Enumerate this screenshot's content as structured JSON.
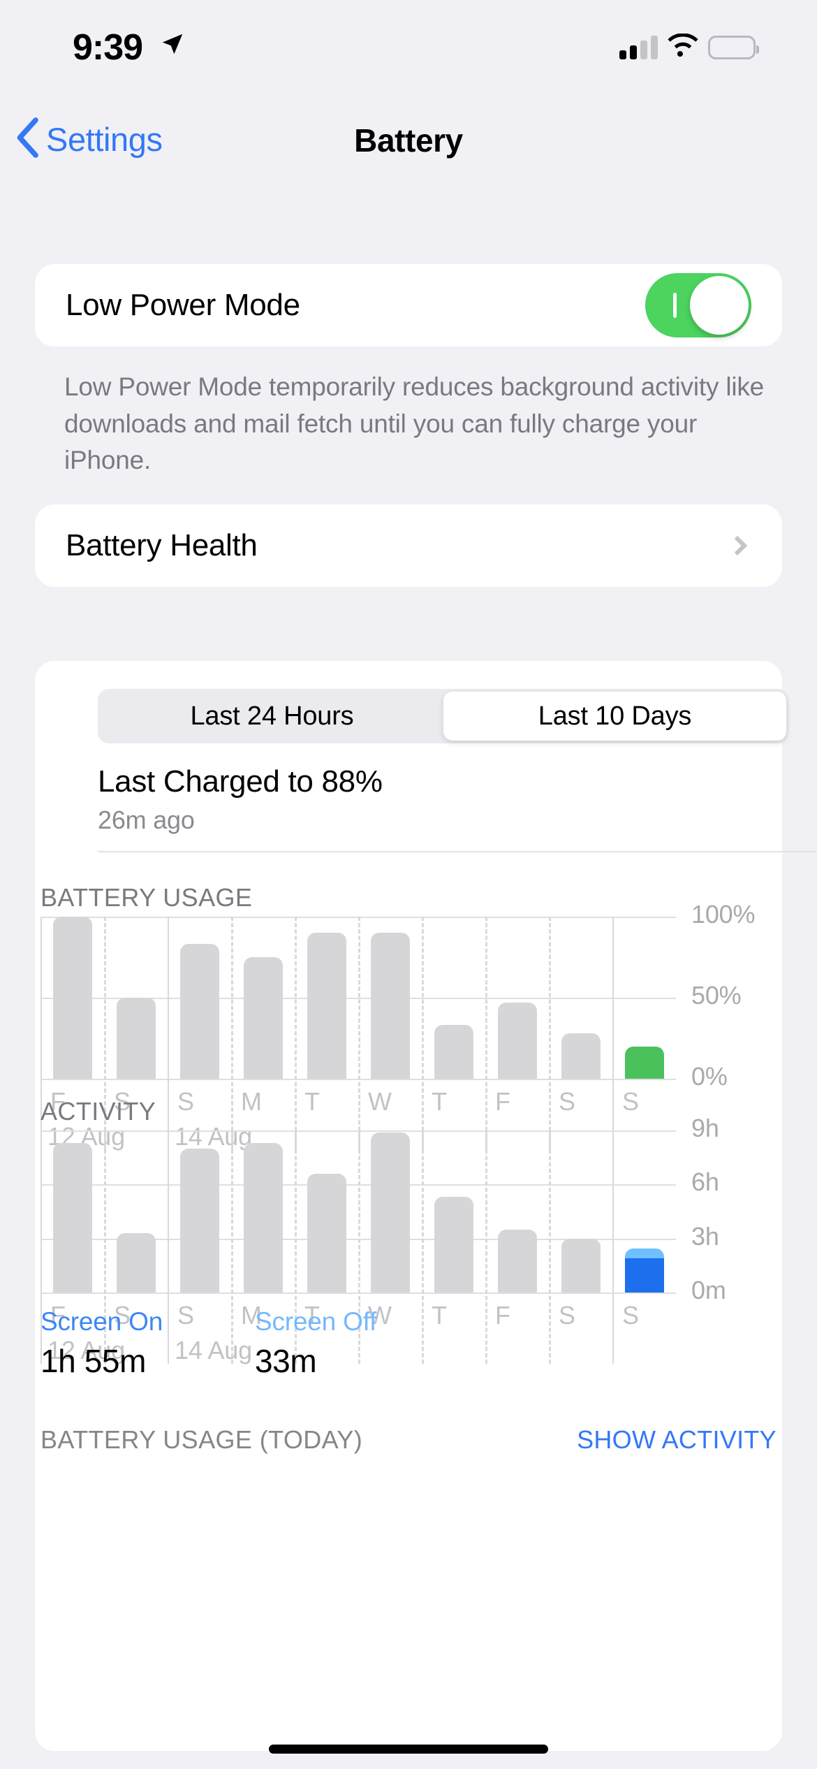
{
  "status_bar": {
    "time": "9:39",
    "location_icon": "location-arrow-icon",
    "cellular_icon": "cellular-signal-icon",
    "cellular_bars_filled": 2,
    "cellular_bars_total": 4,
    "wifi_icon": "wifi-icon",
    "battery_icon": "battery-icon",
    "battery_color": "#F8CE46"
  },
  "nav": {
    "back_label": "Settings",
    "back_icon": "chevron-left-icon",
    "title": "Battery",
    "tint": "#3478F6"
  },
  "low_power": {
    "label": "Low Power Mode",
    "toggle_state": "on",
    "toggle_color": "#4CD45F",
    "footnote": "Low Power Mode temporarily reduces background activity like downloads and mail fetch until you can fully charge your iPhone."
  },
  "battery_health": {
    "label": "Battery Health",
    "disclosure_icon": "chevron-right-icon"
  },
  "usage_card": {
    "segments": [
      {
        "label": "Last 24 Hours",
        "selected": false
      },
      {
        "label": "Last 10 Days",
        "selected": true
      }
    ],
    "last_charged_title": "Last Charged to 88%",
    "last_charged_sub": "26m ago"
  },
  "stats": {
    "screen_on_label": "Screen On",
    "screen_on_value": "1h 55m",
    "screen_on_color": "#3C87F6",
    "screen_off_label": "Screen Off",
    "screen_off_value": "33m",
    "screen_off_color": "#76B8FC"
  },
  "bottom": {
    "section_header": "BATTERY USAGE (TODAY)",
    "show_activity": "SHOW ACTIVITY"
  },
  "chart_data": [
    {
      "type": "bar",
      "title": "BATTERY USAGE",
      "xlabel": "",
      "ylabel": "",
      "categories": [
        "F",
        "S",
        "S",
        "M",
        "T",
        "W",
        "T",
        "F",
        "S",
        "S"
      ],
      "date_labels": [
        {
          "text": "12 Aug",
          "index": 0
        },
        {
          "text": "14 Aug",
          "index": 2
        }
      ],
      "values": [
        100,
        50,
        83,
        75,
        90,
        90,
        33,
        47,
        28,
        20
      ],
      "highlight_index": 9,
      "highlight_color": "#4BC15C",
      "bar_color": "#D6D6D9",
      "ylim": [
        0,
        100
      ],
      "yticks": [
        0,
        50,
        100
      ],
      "ytick_labels": [
        "0%",
        "50%",
        "100%"
      ],
      "grid": true,
      "legend": "none"
    },
    {
      "type": "bar",
      "title": "ACTIVITY",
      "xlabel": "",
      "ylabel": "",
      "categories": [
        "F",
        "S",
        "S",
        "M",
        "T",
        "W",
        "T",
        "F",
        "S",
        "S"
      ],
      "date_labels": [
        {
          "text": "12 Aug",
          "index": 0
        },
        {
          "text": "14 Aug",
          "index": 2
        }
      ],
      "values": [
        8.3,
        3.3,
        8.0,
        8.3,
        6.6,
        8.9,
        5.3,
        3.5,
        3.0,
        2.45
      ],
      "series": [
        {
          "name": "Screen On",
          "color": "#1E6FEE",
          "highlight_only_value": 1.92
        },
        {
          "name": "Screen Off",
          "color": "#6EC0FF",
          "highlight_only_value": 0.53
        }
      ],
      "highlight_index": 9,
      "bar_color": "#D6D6D9",
      "ylim": [
        0,
        9
      ],
      "yticks": [
        0,
        3,
        6,
        9
      ],
      "ytick_labels": [
        "0m",
        "3h",
        "6h",
        "9h"
      ],
      "grid": true,
      "legend": "none"
    }
  ]
}
